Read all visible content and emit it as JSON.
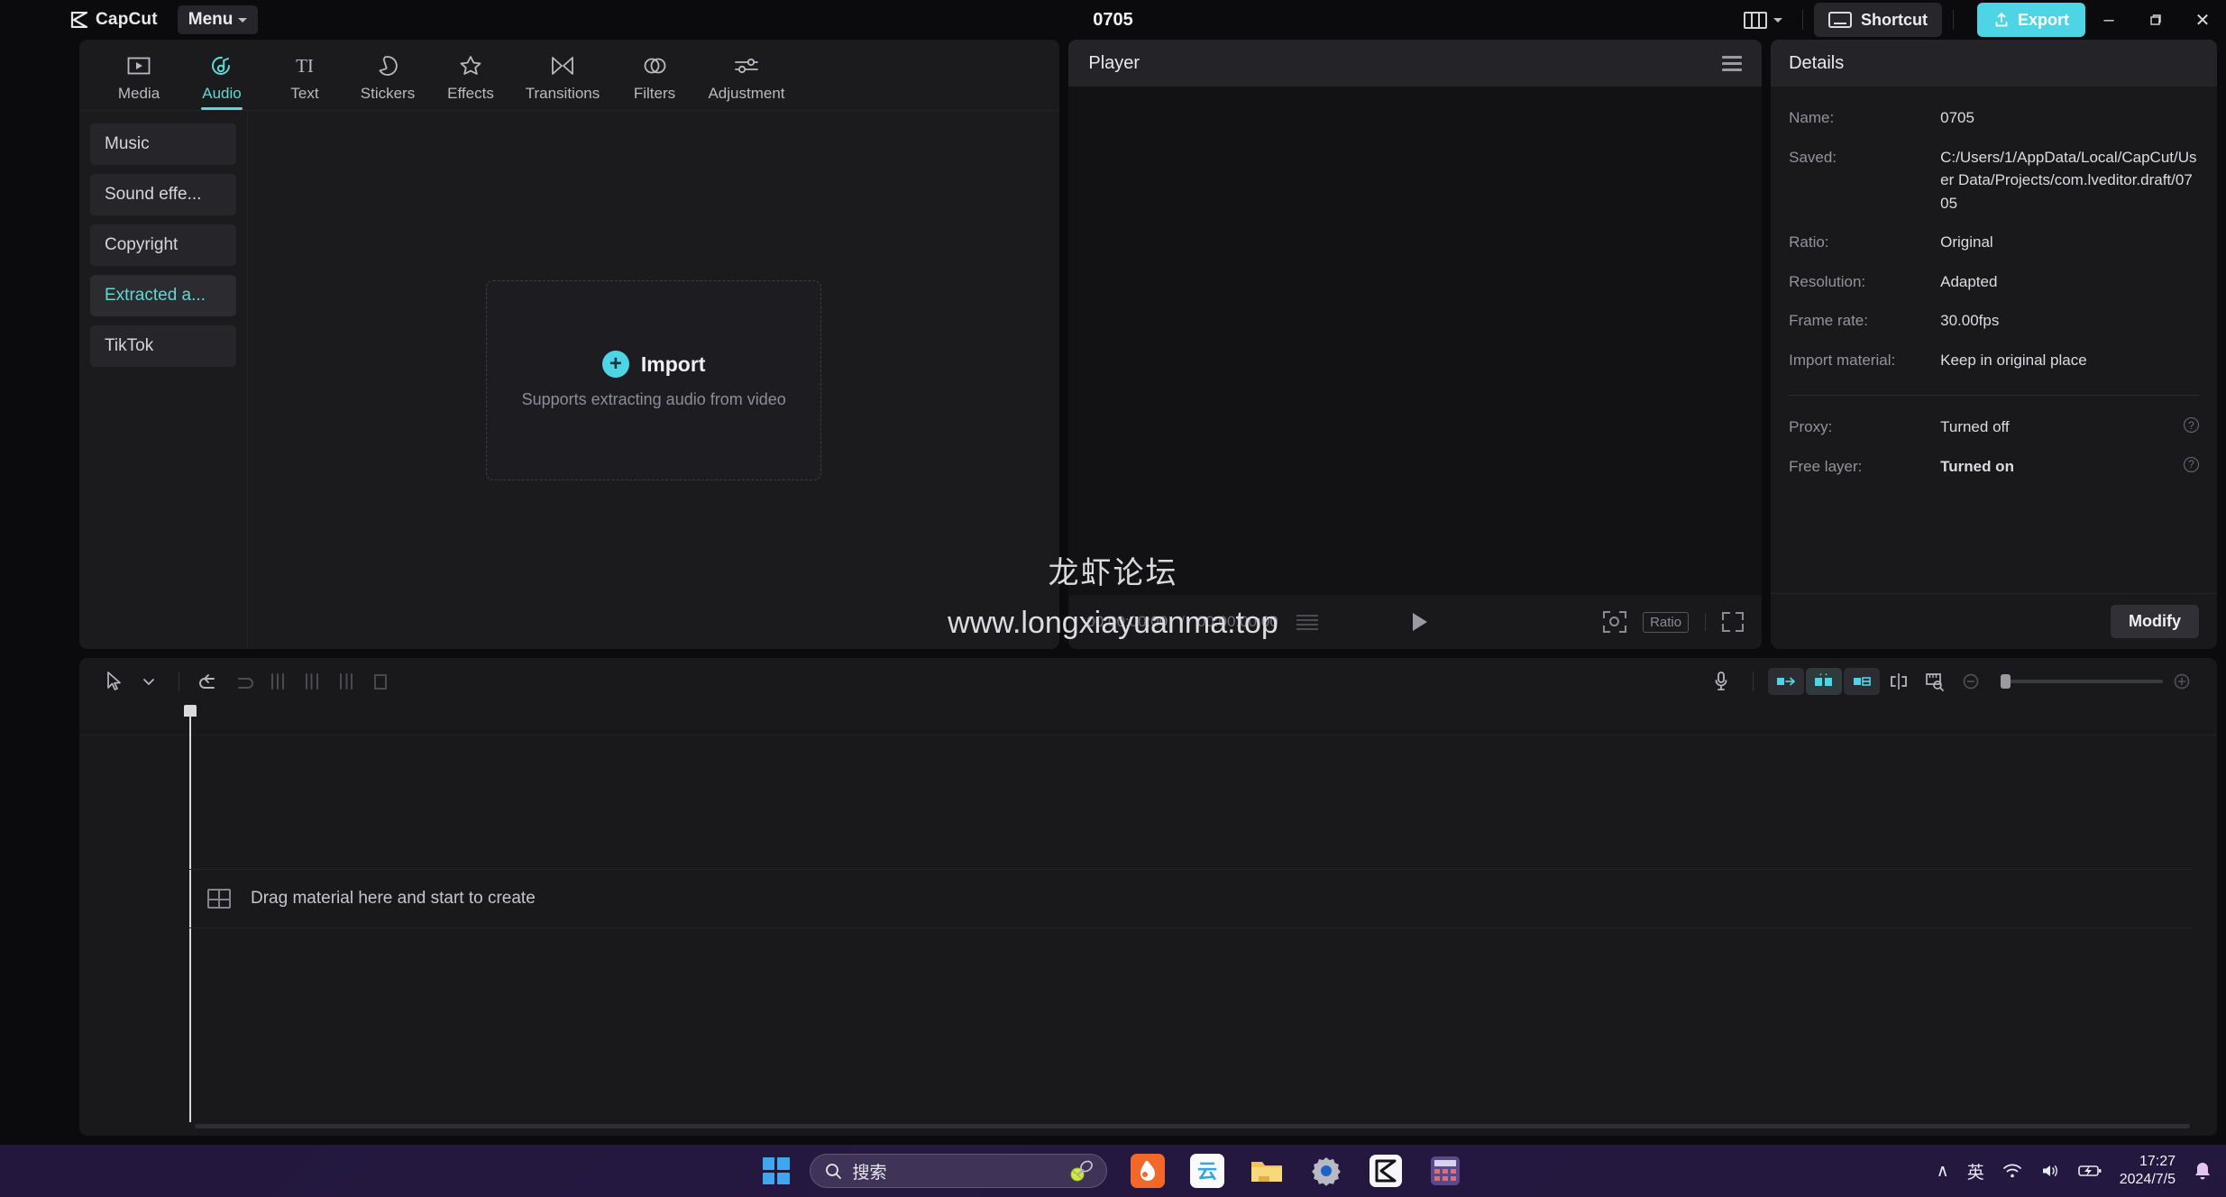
{
  "titlebar": {
    "brand": "CapCut",
    "menu_label": "Menu",
    "project_title": "0705",
    "layout_icon": "layout-icon",
    "shortcut_label": "Shortcut",
    "export_label": "Export",
    "minimize": "–",
    "maximize": "❐",
    "close": "✕",
    "accent": "#4ed5e5"
  },
  "tabs": [
    {
      "label": "Media",
      "icon": "media-icon",
      "active": false
    },
    {
      "label": "Audio",
      "icon": "audio-icon",
      "active": true
    },
    {
      "label": "Text",
      "icon": "text-icon",
      "active": false
    },
    {
      "label": "Stickers",
      "icon": "stickers-icon",
      "active": false
    },
    {
      "label": "Effects",
      "icon": "effects-icon",
      "active": false
    },
    {
      "label": "Transitions",
      "icon": "transitions-icon",
      "active": false
    },
    {
      "label": "Filters",
      "icon": "filters-icon",
      "active": false
    },
    {
      "label": "Adjustment",
      "icon": "adjustment-icon",
      "active": false
    }
  ],
  "sidebar": {
    "items": [
      {
        "label": "Music",
        "active": false
      },
      {
        "label": "Sound effe...",
        "active": false
      },
      {
        "label": "Copyright",
        "active": false
      },
      {
        "label": "Extracted a...",
        "active": true
      },
      {
        "label": "TikTok",
        "active": false
      }
    ]
  },
  "import": {
    "label": "Import",
    "sub": "Supports extracting audio from video",
    "plus": "+"
  },
  "player": {
    "title": "Player",
    "current_time": "00:00:00:00",
    "separator": "/",
    "total_time": "00:00:00:00",
    "ratio_label": "Ratio"
  },
  "details": {
    "title": "Details",
    "rows": [
      {
        "label": "Name:",
        "value": "0705"
      },
      {
        "label": "Saved:",
        "value": "C:/Users/1/AppData/Local/CapCut/User Data/Projects/com.lveditor.draft/0705"
      },
      {
        "label": "Ratio:",
        "value": "Original"
      },
      {
        "label": "Resolution:",
        "value": "Adapted"
      },
      {
        "label": "Frame rate:",
        "value": "30.00fps"
      },
      {
        "label": "Import material:",
        "value": "Keep in original place"
      }
    ],
    "toggles": [
      {
        "label": "Proxy:",
        "value": "Turned off",
        "help": "?"
      },
      {
        "label": "Free layer:",
        "value": "Turned on",
        "help": "?"
      }
    ],
    "modify_label": "Modify"
  },
  "timeline": {
    "drag_hint": "Drag material here and start to create",
    "tools": [
      {
        "name": "select-tool",
        "state": "active"
      },
      {
        "name": "chevron-down-icon",
        "state": "active"
      },
      {
        "name": "undo-icon",
        "state": "active"
      },
      {
        "name": "redo-icon",
        "state": "dim"
      },
      {
        "name": "split-left-icon",
        "state": "dim"
      },
      {
        "name": "split-icon",
        "state": "dim"
      },
      {
        "name": "split-right-icon",
        "state": "dim"
      },
      {
        "name": "delete-icon",
        "state": "dim"
      }
    ],
    "right_tools": [
      {
        "name": "microphone-icon"
      },
      {
        "name": "auto-trim-left-icon"
      },
      {
        "name": "auto-cut-icon"
      },
      {
        "name": "auto-trim-right-icon"
      },
      {
        "name": "split-marker-icon"
      },
      {
        "name": "ruler-icon"
      },
      {
        "name": "zoom-out-icon"
      },
      {
        "name": "zoom-in-icon"
      }
    ]
  },
  "watermark": {
    "cn": "龙虾论坛",
    "url": "www.longxiayuanma.top"
  },
  "taskbar": {
    "search_placeholder": "搜索",
    "search_icon": "search-icon",
    "apps": [
      {
        "name": "tennis-icon"
      },
      {
        "name": "orange-app-icon"
      },
      {
        "name": "cloud-app-icon"
      },
      {
        "name": "folder-icon"
      },
      {
        "name": "settings-gear-icon"
      },
      {
        "name": "capcut-taskbar-icon"
      },
      {
        "name": "calculator-icon"
      }
    ],
    "chevron_up": "∧",
    "ime": "英",
    "wifi": "wifi-icon",
    "volume": "volume-icon",
    "battery": "battery-icon",
    "time": "17:27",
    "date": "2024/7/5",
    "bell": "🔔"
  }
}
